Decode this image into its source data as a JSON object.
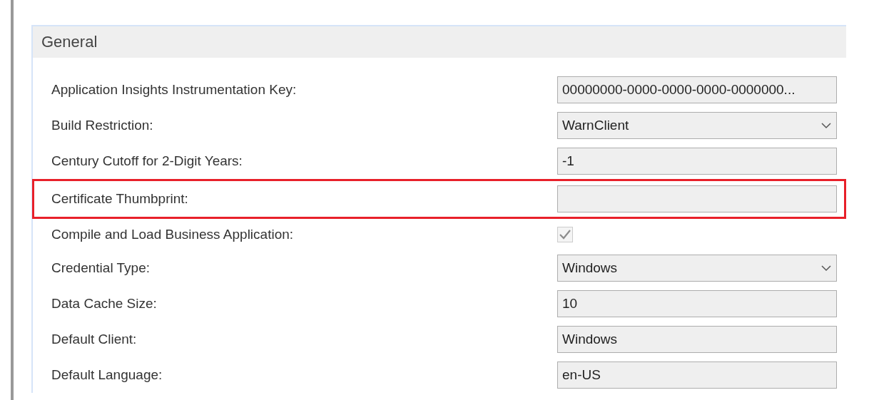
{
  "section": {
    "title": "General"
  },
  "properties": [
    {
      "label": "Application Insights Instrumentation Key:",
      "kind": "text",
      "value": "00000000-0000-0000-0000-0000000...",
      "highlighted": false
    },
    {
      "label": "Build Restriction:",
      "kind": "dropdown",
      "value": "WarnClient",
      "highlighted": false
    },
    {
      "label": "Century Cutoff for 2-Digit Years:",
      "kind": "text",
      "value": "-1",
      "highlighted": false
    },
    {
      "label": "Certificate Thumbprint:",
      "kind": "text",
      "highlighted": true
    },
    {
      "label": "Compile and Load Business Application:",
      "kind": "checkbox",
      "checked": true,
      "disabled": true,
      "highlighted": false
    },
    {
      "label": "Credential Type:",
      "kind": "dropdown",
      "value": "Windows",
      "highlighted": false
    },
    {
      "label": "Data Cache Size:",
      "kind": "text",
      "value": "10",
      "highlighted": false
    },
    {
      "label": "Default Client:",
      "kind": "text",
      "value": "Windows",
      "highlighted": false
    },
    {
      "label": "Default Language:",
      "kind": "text",
      "value": "en-US",
      "highlighted": false
    }
  ]
}
